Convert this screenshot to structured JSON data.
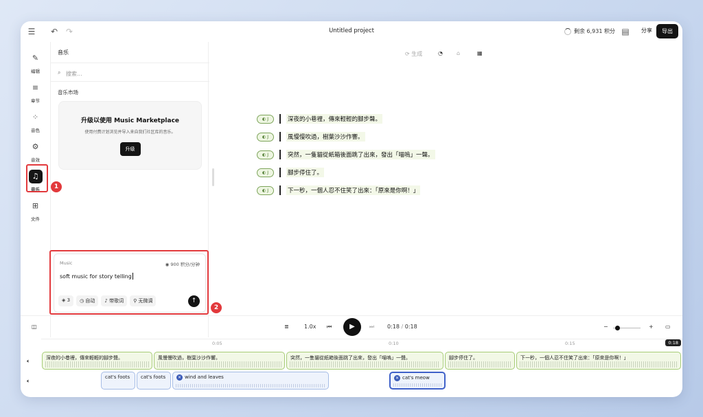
{
  "header": {
    "title": "Untitled project",
    "credits": "剩余 6,931 积分",
    "share": "分享",
    "export": "导出"
  },
  "rail": {
    "items": [
      {
        "label": "编辑",
        "icon": "sparkle-pen-icon"
      },
      {
        "label": "章节",
        "icon": "list-icon"
      },
      {
        "label": "音色",
        "icon": "grid-circles-icon"
      },
      {
        "label": "音效",
        "icon": "gear-icon"
      },
      {
        "label": "音乐",
        "icon": "music-note-icon"
      },
      {
        "label": "文件",
        "icon": "folder-icon"
      }
    ],
    "callout_1": "1",
    "callout_2": "2"
  },
  "music_panel": {
    "title": "音乐",
    "search_placeholder": "搜索...",
    "market_label": "音乐市场",
    "market_card": {
      "heading": "升级以使用 Music Marketplace",
      "subtext": "使用付费计划浏览并导入来自我们社区库的音乐。",
      "button": "升级"
    },
    "prompt_box": {
      "label": "Music",
      "cost": "900 积分/分钟",
      "text": "soft music for story telling",
      "chips": [
        "3",
        "自动",
        "带歌词",
        "无微调"
      ]
    }
  },
  "editor": {
    "toolbar": {
      "generate": "生成"
    },
    "speaker_tag": "J",
    "lines": [
      "深夜的小巷裡，傳來輕輕的腳步聲。",
      "風慢慢吹過，樹葉沙沙作響。",
      "突然，一隻貓從紙箱後面跳了出來，發出「喵嗚」一聲。",
      "腳步停住了。",
      "下一秒，一個人忍不住笑了出來：「原來是你啊！」"
    ]
  },
  "transport": {
    "speed": "1.0x",
    "current": "0:18",
    "separator": "/",
    "total": "0:18",
    "zoom_minus": "−",
    "zoom_plus": "+"
  },
  "timeline": {
    "ticks": [
      "0:05",
      "0:10",
      "0:15"
    ],
    "playhead": "0:18",
    "voice_clips": [
      "深夜的小巷裡，傳來輕輕的腳步聲。",
      "風慢慢吹過，樹葉沙沙作響。",
      "突然，一隻貓從紙箱後面跳了出來，發出「喵嗚」一聲。",
      "腳步停住了。",
      "下一秒，一個人忍不住笑了出來：「原來是你啊！」"
    ],
    "sfx_clips": [
      "cat's foots",
      "cat's foots",
      "wind and leaves",
      "cat's meow"
    ]
  }
}
